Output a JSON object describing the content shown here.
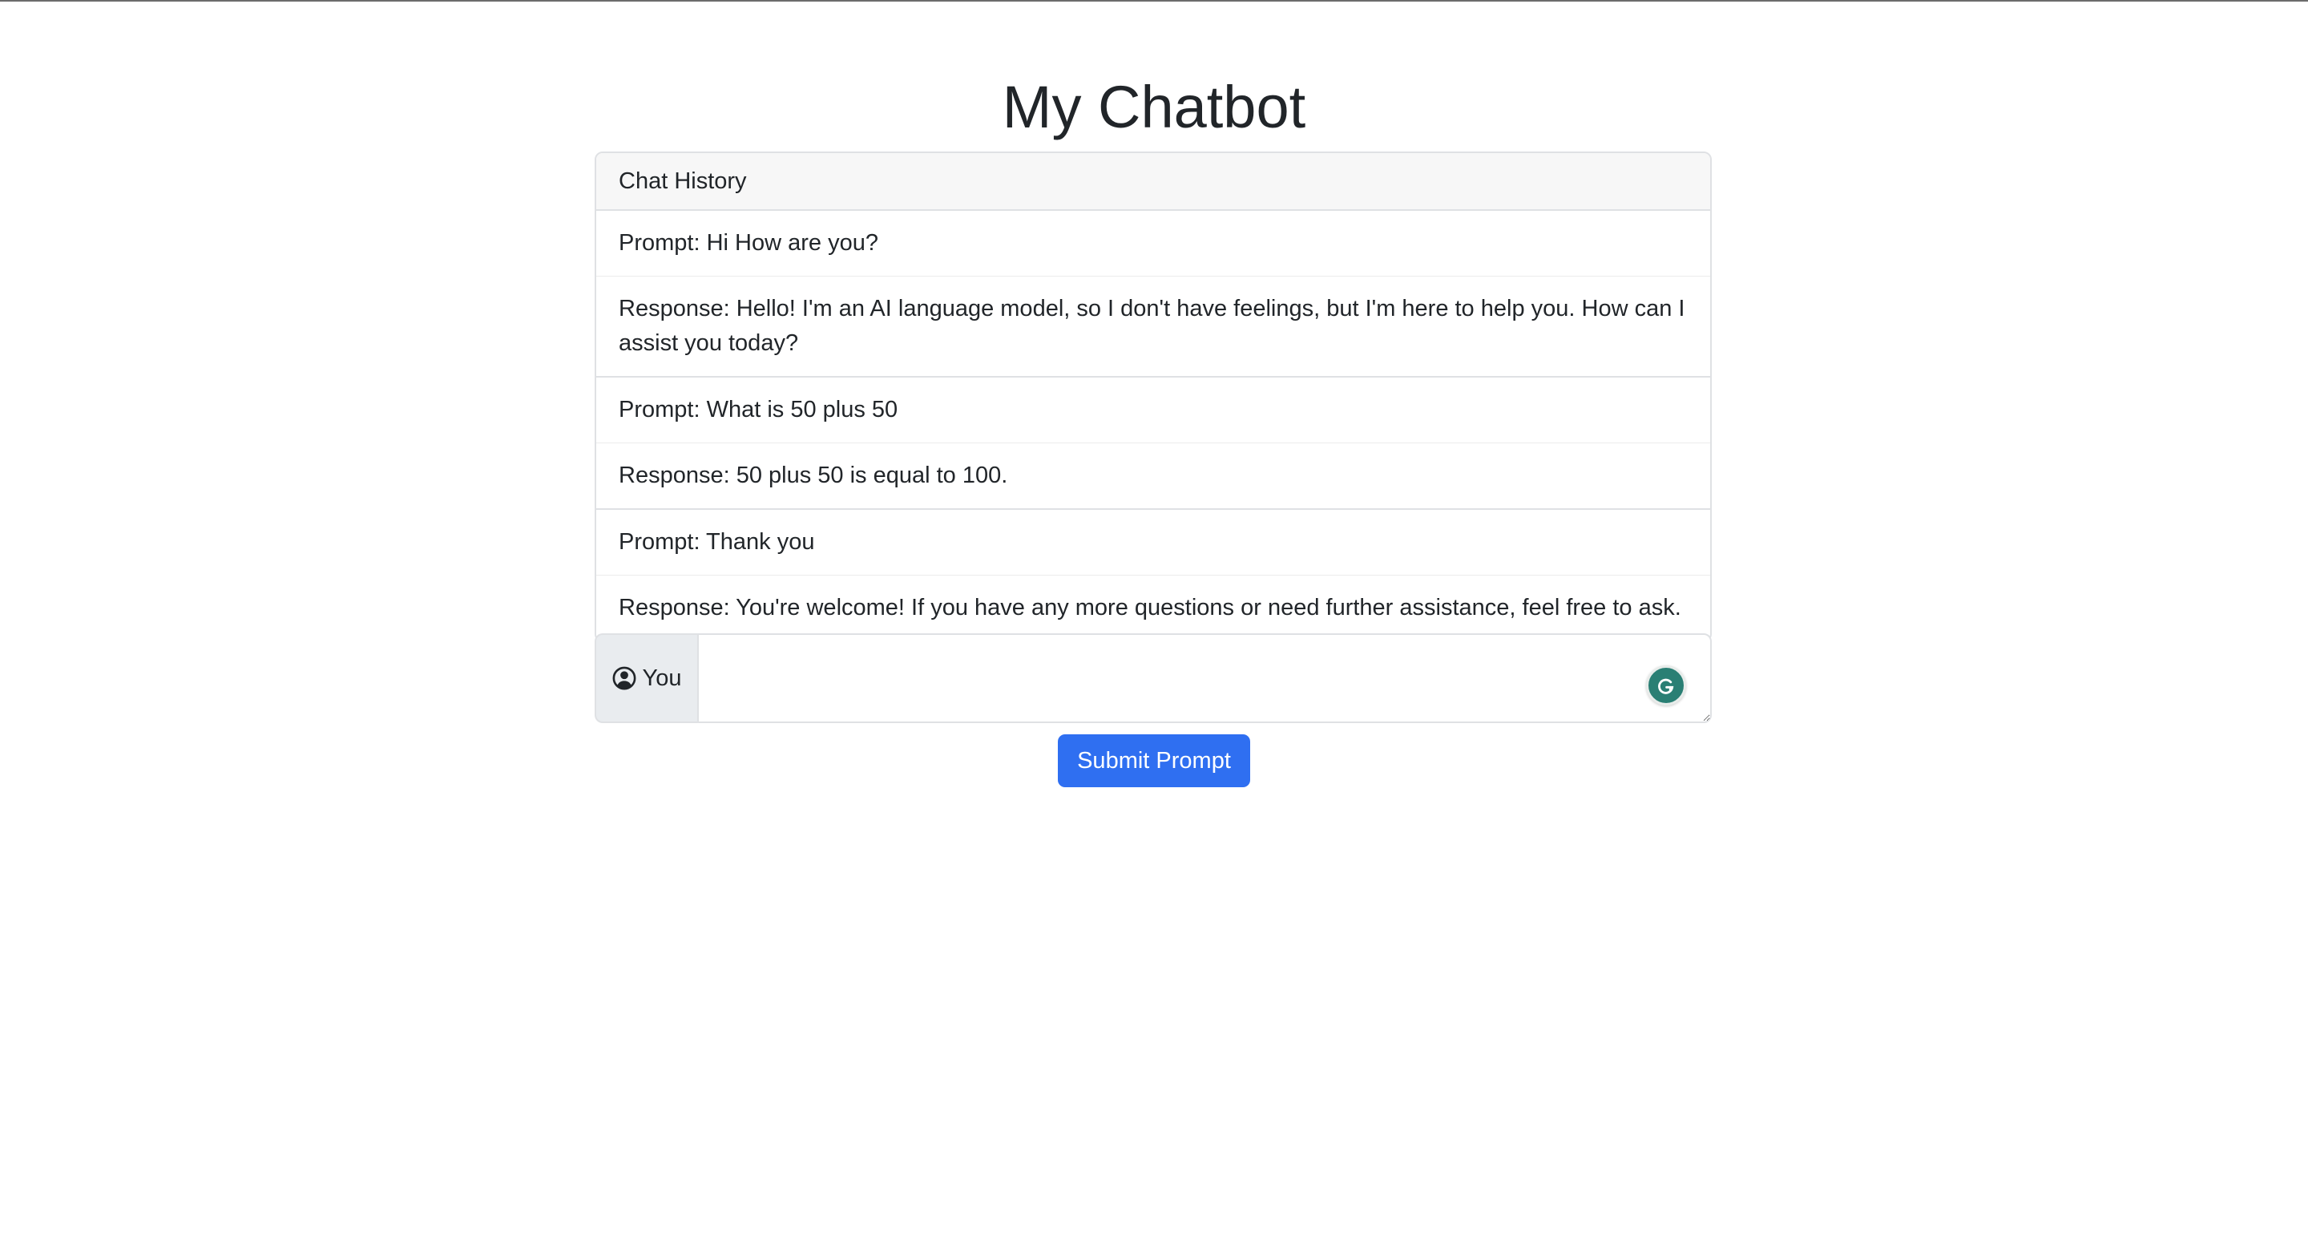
{
  "page": {
    "title": "My Chatbot"
  },
  "chat_history": {
    "header": "Chat History",
    "entries": [
      {
        "type": "prompt",
        "text": "Prompt: Hi How are you?"
      },
      {
        "type": "response",
        "text": "Response: Hello! I'm an AI language model, so I don't have feelings, but I'm here to help you. How can I assist you today?"
      },
      {
        "type": "prompt",
        "text": "Prompt: What is 50 plus 50"
      },
      {
        "type": "response",
        "text": "Response: 50 plus 50 is equal to 100."
      },
      {
        "type": "prompt",
        "text": "Prompt: Thank you"
      },
      {
        "type": "response",
        "text": "Response: You're welcome! If you have any more questions or need further assistance, feel free to ask."
      }
    ]
  },
  "input": {
    "label": "You",
    "icon": "person-circle-icon",
    "value": "",
    "assistant_icon": "grammarly-icon"
  },
  "actions": {
    "submit_label": "Submit Prompt"
  },
  "colors": {
    "primary": "#2f6ff1",
    "border": "#dfe1e4",
    "addon_bg": "#e9ecef",
    "header_bg": "#f7f7f7"
  }
}
